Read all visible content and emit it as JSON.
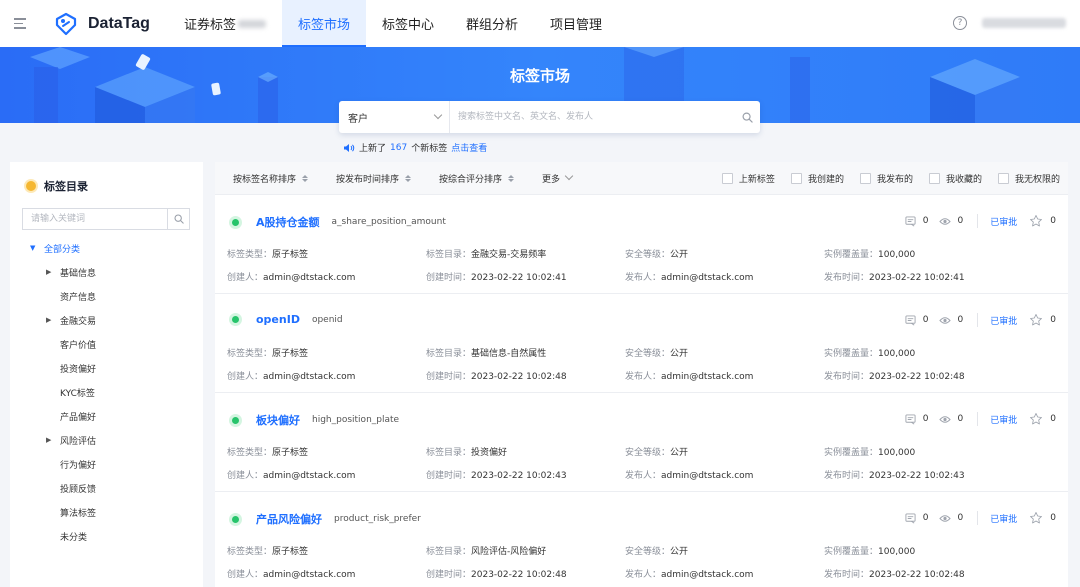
{
  "app": {
    "name": "DataTag"
  },
  "nav": [
    {
      "label": "证券标签",
      "active": false
    },
    {
      "label": "标签市场",
      "active": true
    },
    {
      "label": "标签中心",
      "active": false
    },
    {
      "label": "群组分析",
      "active": false
    },
    {
      "label": "项目管理",
      "active": false
    }
  ],
  "header": {
    "help_icon": "?"
  },
  "banner": {
    "title": "标签市场"
  },
  "search": {
    "selected": "客户",
    "placeholder": "搜索标签中文名、英文名、发布人"
  },
  "notice": {
    "prefix": "上新了",
    "count": "167",
    "suffix": "个新标签",
    "link": "点击查看"
  },
  "sidebar": {
    "title": "标签目录",
    "search_placeholder": "请输入关键词",
    "root": "全部分类",
    "items": [
      {
        "label": "基础信息",
        "expandable": true
      },
      {
        "label": "资产信息",
        "expandable": false
      },
      {
        "label": "金融交易",
        "expandable": true
      },
      {
        "label": "客户价值",
        "expandable": false
      },
      {
        "label": "投资偏好",
        "expandable": false
      },
      {
        "label": "KYC标签",
        "expandable": false
      },
      {
        "label": "产品偏好",
        "expandable": false
      },
      {
        "label": "风险评估",
        "expandable": true
      },
      {
        "label": "行为偏好",
        "expandable": false
      },
      {
        "label": "投顾反馈",
        "expandable": false
      },
      {
        "label": "算法标签",
        "expandable": false
      },
      {
        "label": "未分类",
        "expandable": false
      }
    ]
  },
  "sortbar": {
    "sorts": [
      "按标签名称排序",
      "按发布时间排序",
      "按综合评分排序"
    ],
    "more": "更多",
    "filters": [
      "上新标签",
      "我创建的",
      "我发布的",
      "我收藏的",
      "我无权限的"
    ]
  },
  "labels": {
    "type": "标签类型：",
    "catalog": "标签目录：",
    "security": "安全等级：",
    "coverage": "实例覆盖量：",
    "creator": "创建人：",
    "created": "创建时间：",
    "publisher": "发布人：",
    "published": "发布时间：",
    "approved": "已审批"
  },
  "cards": [
    {
      "name": "A股持仓金额",
      "code": "a_share_position_amount",
      "comments": "0",
      "views": "0",
      "stars": "0",
      "type": "原子标签",
      "catalog": "金融交易-交易频率",
      "security": "公开",
      "coverage": "100,000",
      "creator": "admin@dtstack.com",
      "created": "2023-02-22 10:02:41",
      "publisher": "admin@dtstack.com",
      "published": "2023-02-22 10:02:41"
    },
    {
      "name": "openID",
      "code": "openid",
      "comments": "0",
      "views": "0",
      "stars": "0",
      "type": "原子标签",
      "catalog": "基础信息-自然属性",
      "security": "公开",
      "coverage": "100,000",
      "creator": "admin@dtstack.com",
      "created": "2023-02-22 10:02:48",
      "publisher": "admin@dtstack.com",
      "published": "2023-02-22 10:02:48"
    },
    {
      "name": "板块偏好",
      "code": "high_position_plate",
      "comments": "0",
      "views": "0",
      "stars": "0",
      "type": "原子标签",
      "catalog": "投资偏好",
      "security": "公开",
      "coverage": "100,000",
      "creator": "admin@dtstack.com",
      "created": "2023-02-22 10:02:43",
      "publisher": "admin@dtstack.com",
      "published": "2023-02-22 10:02:43"
    },
    {
      "name": "产品风险偏好",
      "code": "product_risk_prefer",
      "comments": "0",
      "views": "0",
      "stars": "0",
      "type": "原子标签",
      "catalog": "风险评估-风险偏好",
      "security": "公开",
      "coverage": "100,000",
      "creator": "admin@dtstack.com",
      "created": "2023-02-22 10:02:48",
      "publisher": "admin@dtstack.com",
      "published": "2023-02-22 10:02:48"
    }
  ],
  "icons": [
    "menu-icon",
    "datatag-logo-icon",
    "help-icon",
    "search-icon",
    "speaker-icon",
    "catalog-dot-icon",
    "sort-icon",
    "chevron-down-icon",
    "comment-icon",
    "eye-icon",
    "star-icon",
    "status-dot-icon"
  ],
  "colors": {
    "primary": "#1f6fff",
    "banner": "#2f7bf8",
    "status_green": "#27c46b",
    "catalog_dot": "#f5b731"
  }
}
